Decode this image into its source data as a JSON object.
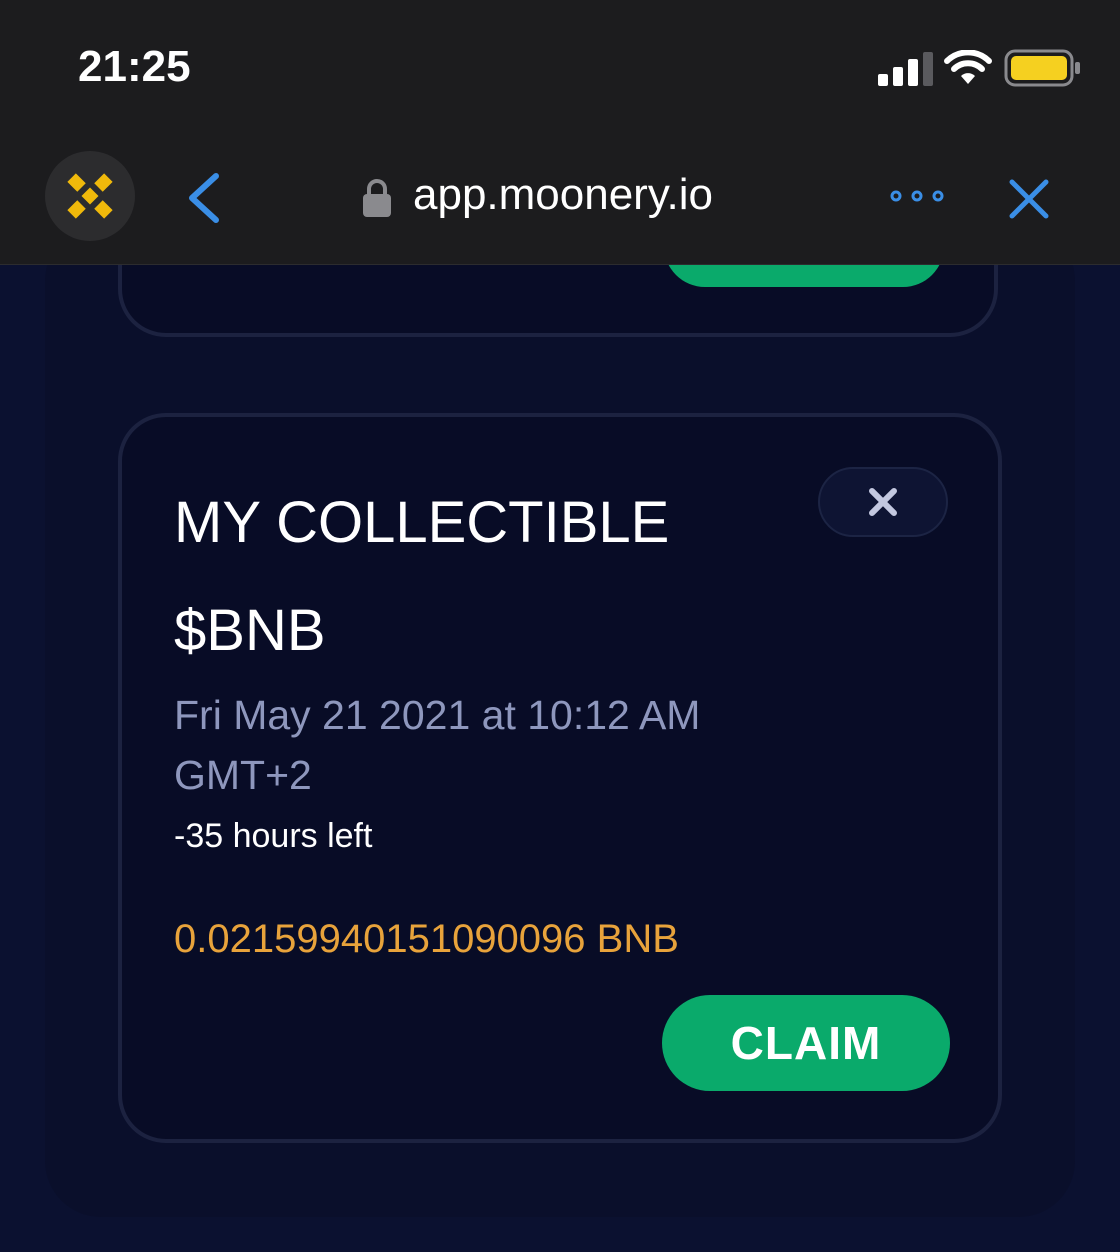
{
  "status_bar": {
    "time": "21:25",
    "battery_color": "#f5d020"
  },
  "browser": {
    "url": "app.moonery.io",
    "icons": [
      "binance-logo",
      "back-icon",
      "lock-icon",
      "more-icon",
      "close-icon"
    ],
    "accent_color": "#3a8ee6"
  },
  "card": {
    "title": "MY COLLECTIBLE",
    "token": "$BNB",
    "date_line1": "Fri May 21 2021 at 10:12 AM",
    "date_line2": "GMT+2",
    "time_left": "-35 hours left",
    "amount": "0.021599401510900​96 BNB",
    "claim_label": "CLAIM",
    "claim_color": "#0aaa6b",
    "amount_color": "#e8a33b"
  }
}
